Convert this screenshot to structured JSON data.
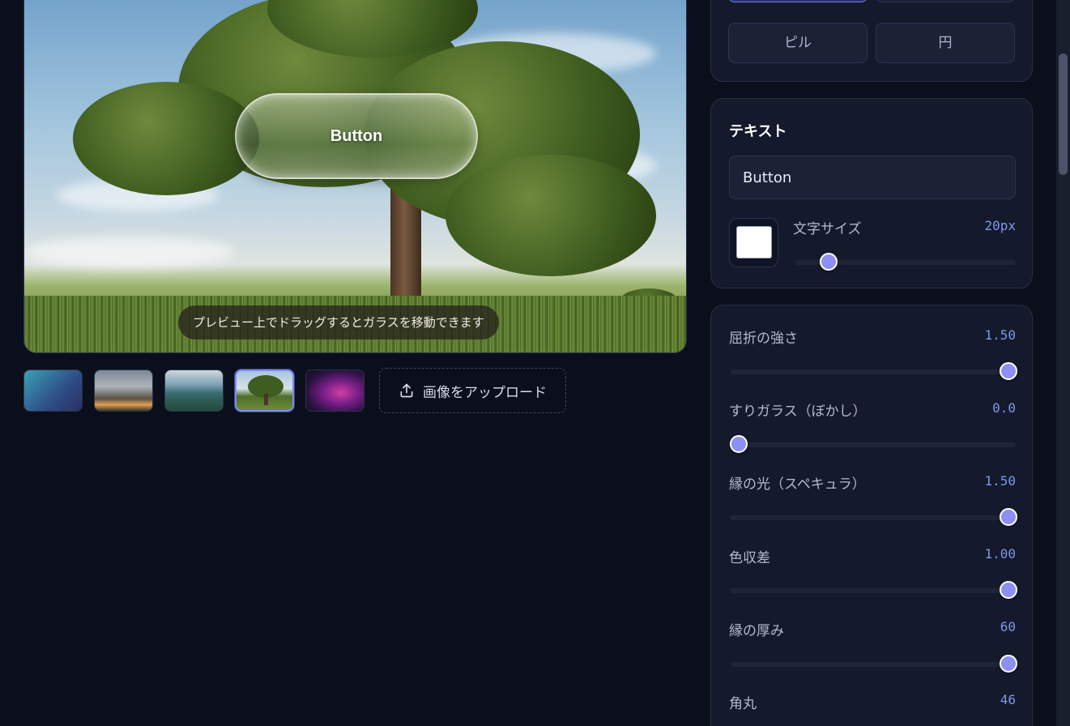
{
  "preview": {
    "glass_button_text": "Button",
    "drag_hint": "プレビュー上でドラッグするとガラスを移動できます"
  },
  "thumbnails": [
    {
      "name": "gradient-teal"
    },
    {
      "name": "city"
    },
    {
      "name": "lake-mountains"
    },
    {
      "name": "tree",
      "selected": true
    },
    {
      "name": "purple-abstract"
    }
  ],
  "upload": {
    "label": "画像をアップロード",
    "icon": "upload-icon"
  },
  "shape": {
    "options": [
      "ピル",
      "円"
    ]
  },
  "text_section": {
    "title": "テキスト",
    "input_value": "Button",
    "text_color": "#ffffff",
    "font_size": {
      "label": "文字サイズ",
      "value": "20px",
      "fraction": 0.15
    }
  },
  "effects": [
    {
      "label": "屈折の強さ",
      "value": "1.50",
      "fraction": 1.0
    },
    {
      "label": "すりガラス（ぼかし）",
      "value": "0.0",
      "fraction": 0.0
    },
    {
      "label": "縁の光（スペキュラ）",
      "value": "1.50",
      "fraction": 1.0
    },
    {
      "label": "色収差",
      "value": "1.00",
      "fraction": 1.0
    },
    {
      "label": "縁の厚み",
      "value": "60",
      "fraction": 1.0
    },
    {
      "label": "角丸",
      "value": "46"
    }
  ],
  "colors": {
    "accent": "#8d8ff3",
    "value_text": "#7f97e8",
    "background": "#0b0f1c"
  }
}
